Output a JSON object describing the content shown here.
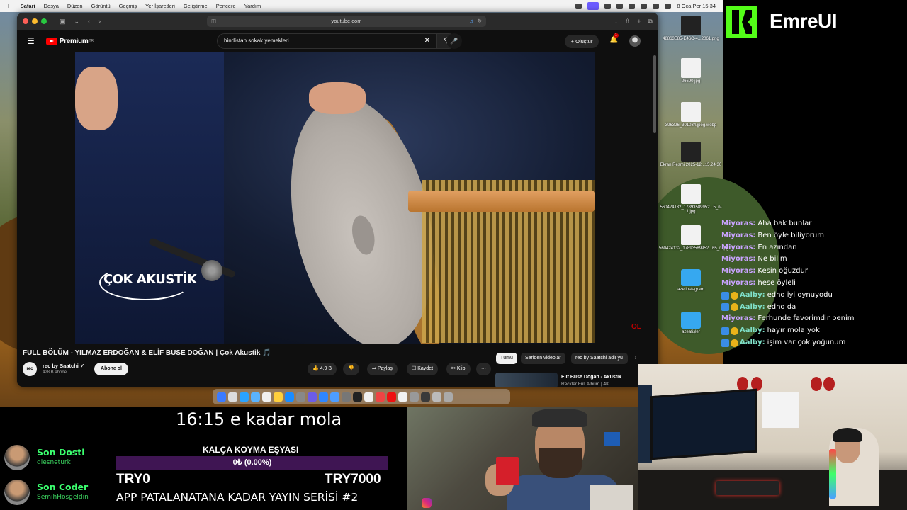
{
  "menubar": {
    "items": [
      "Safari",
      "Dosya",
      "Düzen",
      "Görüntü",
      "Geçmiş",
      "Yer İşaretleri",
      "Geliştirme",
      "Pencere",
      "Yardım"
    ],
    "datetime": "8 Oca Per 15:34"
  },
  "safari": {
    "url": "youtube.com"
  },
  "youtube": {
    "logo_text": "Premium",
    "logo_sup": "TR",
    "search_query": "hindistan sokak yemekleri",
    "create_label": "Oluştur",
    "notif_count": "1",
    "video_overlay": "ÇOK AKUSTİK",
    "corner_logo": "OL",
    "title": "FULL BÖLÜM - YILMAZ ERDOĞAN & ELİF BUSE DOĞAN | Çok Akustik 🎵",
    "channel": {
      "avatar_text": "rec",
      "name": "rec by Saatchi ✓",
      "subs": "428 B abone",
      "subscribe": "Abone ol"
    },
    "actions": {
      "likes": "4,9 B",
      "share": "Paylaş",
      "save": "Kaydet",
      "clip": "Klip",
      "more": "···"
    },
    "chips": [
      "Tümü",
      "Seriden videolar",
      "rec by Saatchi adlı yü"
    ],
    "recommended": {
      "title": "Elif Buse Doğan - Akustik",
      "subtitle": "Reckler Full Albüm | 4K"
    }
  },
  "desktop_icons": [
    {
      "label": "48863E85-E46C-4...2061.png",
      "kind": "dark"
    },
    {
      "label": "26690.jpg",
      "kind": "light"
    },
    {
      "label": "396326_301034.jpeg.webp",
      "kind": "light"
    },
    {
      "label": "Ekran Resmi 2025-12...15.24.30",
      "kind": "dark"
    },
    {
      "label": "560424132_17893589952...5_n-1.jpg",
      "kind": "light"
    },
    {
      "label": "560424132_17893589952...65_n.jpg",
      "kind": "light"
    },
    {
      "label": "aze instagram",
      "kind": "folder"
    },
    {
      "label": "azeafişler",
      "kind": "folder"
    }
  ],
  "branding": {
    "name": "EmreUI"
  },
  "chat": [
    {
      "user": "Miyoras:",
      "text": "Aha bak bunlar",
      "color": "#c9a3ff",
      "badges": false
    },
    {
      "user": "Miyoras:",
      "text": "Ben öyle biliyorum",
      "color": "#c9a3ff",
      "badges": false
    },
    {
      "user": "Miyoras:",
      "text": "En azından",
      "color": "#c9a3ff",
      "badges": false
    },
    {
      "user": "Miyoras:",
      "text": "Ne bilim",
      "color": "#c9a3ff",
      "badges": false
    },
    {
      "user": "Miyoras:",
      "text": "Kesin oğuzdur",
      "color": "#c9a3ff",
      "badges": false
    },
    {
      "user": "Miyoras:",
      "text": "hese öyleli",
      "color": "#c9a3ff",
      "badges": false
    },
    {
      "user": "Aalby:",
      "text": "edho iyi oynuyodu",
      "color": "#7fe0c8",
      "badges": true
    },
    {
      "user": "Aalby:",
      "text": "edho da",
      "color": "#7fe0c8",
      "badges": true
    },
    {
      "user": "Miyoras:",
      "text": "Ferhunde favorimdir benim",
      "color": "#c9a3ff",
      "badges": false
    },
    {
      "user": "Aalby:",
      "text": "hayır mola yok",
      "color": "#7fe0c8",
      "badges": true
    },
    {
      "user": "Aalby:",
      "text": "işim var çok yoğunum",
      "color": "#7fe0c8",
      "badges": true
    }
  ],
  "overlay": {
    "break_text": "16:15 e kadar mola",
    "last_follower": {
      "label": "Son Dosti",
      "name": "diesneturk"
    },
    "last_coder": {
      "label": "Son Coder",
      "name": "SemihHosgeldin"
    },
    "goal": {
      "title": "KALÇA KOYMA EŞYASI",
      "percent_text": "0₺ (0.00%)",
      "progress": 0.0,
      "min": "TRY0",
      "max": "TRY7000"
    },
    "series_text": "APP PATALANATANA KADAR YAYIN SERİSİ #2"
  },
  "colors": {
    "accent_green": "#53fc18",
    "yt_red": "#ff0000",
    "goal_purple": "#a23dd6"
  }
}
